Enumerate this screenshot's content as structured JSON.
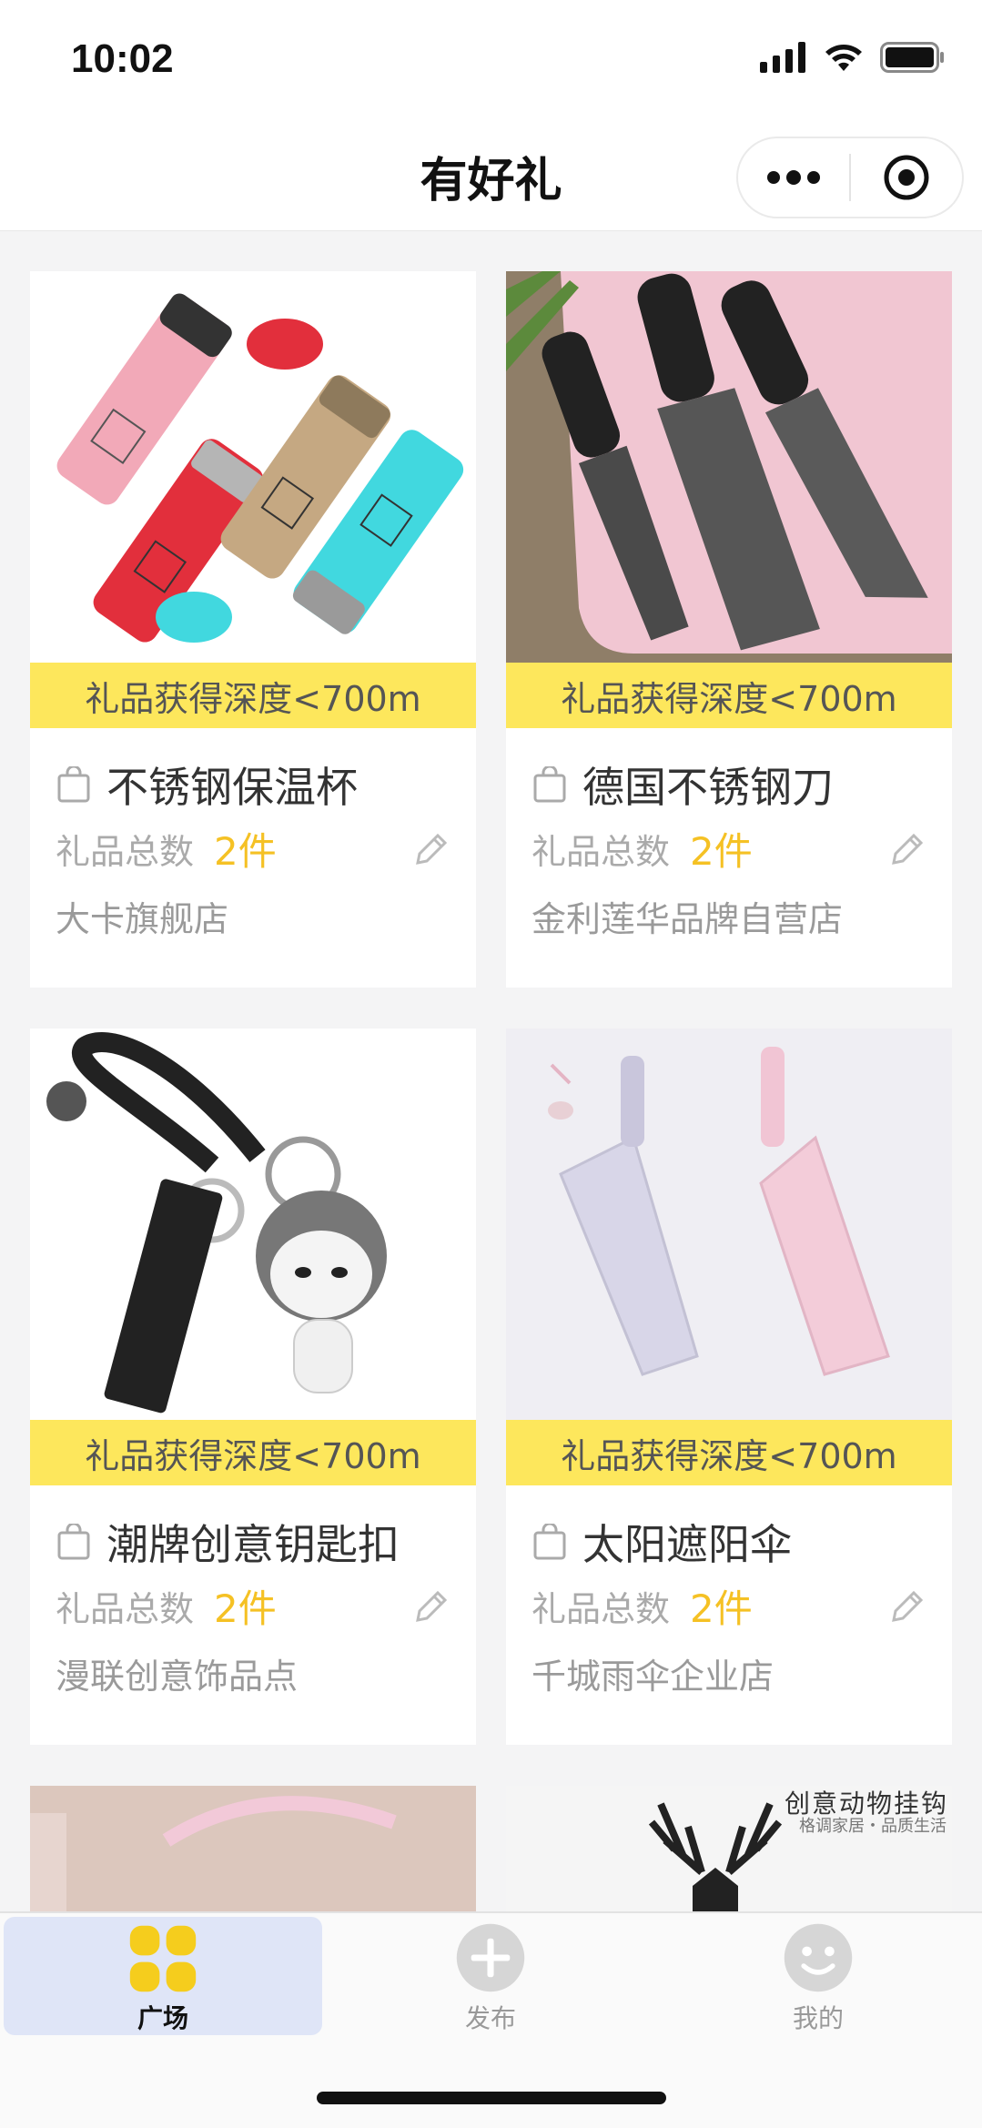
{
  "status": {
    "time": "10:02"
  },
  "nav": {
    "title": "有好礼"
  },
  "cards": [
    {
      "banner": "礼品获得深度<700m",
      "title": "不锈钢保温杯",
      "count_label": "礼品总数",
      "count_value": "2件",
      "store": "大卡旗舰店"
    },
    {
      "banner": "礼品获得深度<700m",
      "title": "德国不锈钢刀",
      "count_label": "礼品总数",
      "count_value": "2件",
      "store": "金利莲华品牌自营店"
    },
    {
      "banner": "礼品获得深度<700m",
      "title": "潮牌创意钥匙扣",
      "count_label": "礼品总数",
      "count_value": "2件",
      "store": "漫联创意饰品点"
    },
    {
      "banner": "礼品获得深度<700m",
      "title": "太阳遮阳伞",
      "count_label": "礼品总数",
      "count_value": "2件",
      "store": "千城雨伞企业店"
    }
  ],
  "partial_cards": [
    {
      "overlay_title": "",
      "overlay_sub": ""
    },
    {
      "overlay_title": "创意动物挂钩",
      "overlay_sub": "格调家居・品质生活"
    }
  ],
  "tabs": [
    {
      "label": "广场",
      "icon": "grid-icon",
      "active": true
    },
    {
      "label": "发布",
      "icon": "plus-icon",
      "active": false
    },
    {
      "label": "我的",
      "icon": "smile-icon",
      "active": false
    }
  ],
  "colors": {
    "accent_yellow": "#fde75c",
    "count_yellow": "#f5c124",
    "active_tab_bg": "#dfe5f7"
  }
}
